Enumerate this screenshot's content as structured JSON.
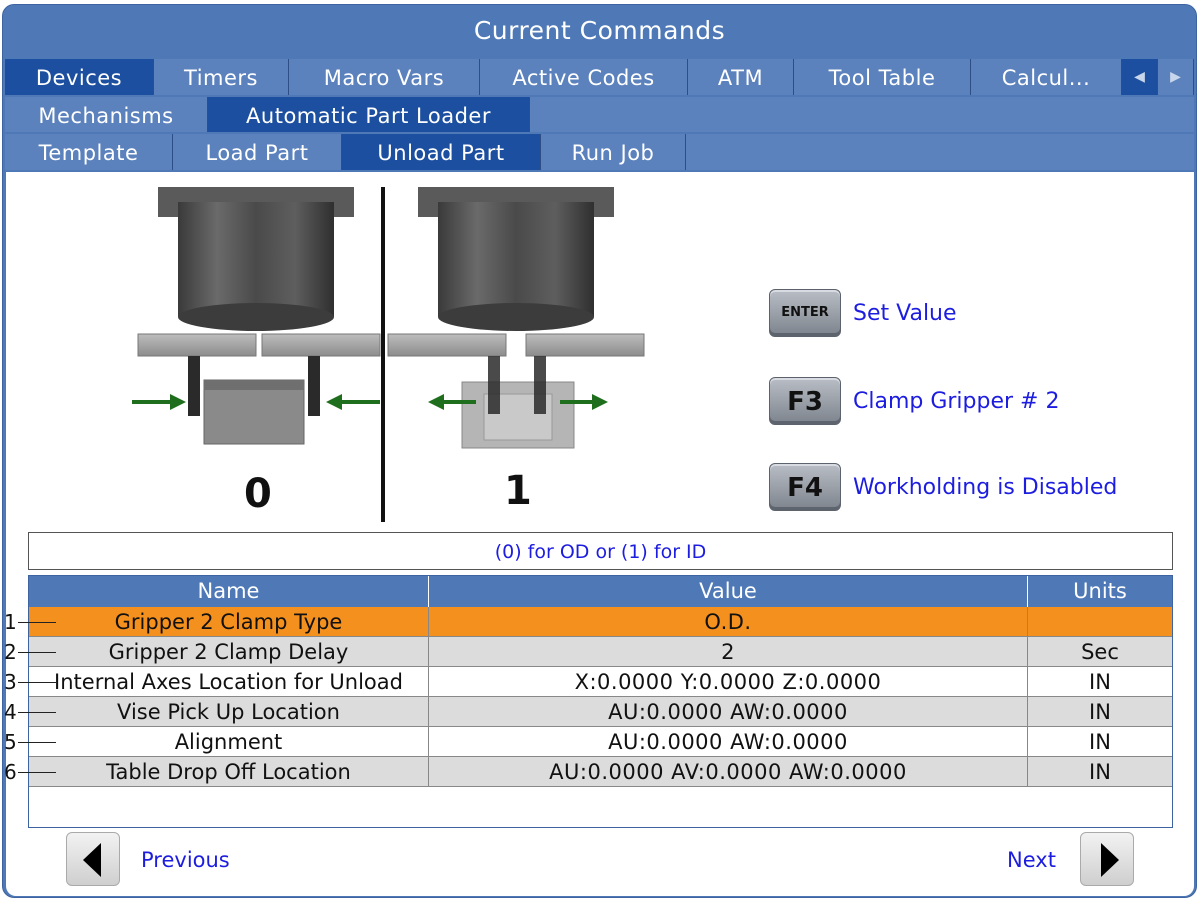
{
  "title": "Current Commands",
  "tabs_row1": [
    {
      "label": "Devices",
      "active": true
    },
    {
      "label": "Timers",
      "active": false
    },
    {
      "label": "Macro Vars",
      "active": false
    },
    {
      "label": "Active Codes",
      "active": false
    },
    {
      "label": "ATM",
      "active": false
    },
    {
      "label": "Tool Table",
      "active": false
    },
    {
      "label": "Calcul...",
      "active": false
    }
  ],
  "tabs_row2": [
    {
      "label": "Mechanisms",
      "active": false
    },
    {
      "label": "Automatic Part Loader",
      "active": true
    }
  ],
  "tabs_row3": [
    {
      "label": "Template",
      "active": false
    },
    {
      "label": "Load Part",
      "active": false
    },
    {
      "label": "Unload Part",
      "active": true
    },
    {
      "label": "Run Job",
      "active": false
    }
  ],
  "illustration": {
    "left_label": "0",
    "right_label": "1"
  },
  "keys": [
    {
      "key": "ENTER",
      "label": "Set Value"
    },
    {
      "key": "F3",
      "label": "Clamp Gripper # 2"
    },
    {
      "key": "F4",
      "label": "Workholding is Disabled"
    }
  ],
  "hint": "(0) for OD or (1) for ID",
  "table": {
    "headers": [
      "Name",
      "Value",
      "Units"
    ],
    "rows": [
      {
        "num": "1",
        "name": "Gripper 2 Clamp Type",
        "value": "O.D.",
        "units": ""
      },
      {
        "num": "2",
        "name": "Gripper 2 Clamp Delay",
        "value": "2",
        "units": "Sec"
      },
      {
        "num": "3",
        "name": "Internal Axes Location for Unload",
        "value": "X:0.0000 Y:0.0000 Z:0.0000",
        "units": "IN"
      },
      {
        "num": "4",
        "name": "Vise Pick Up Location",
        "value": "AU:0.0000 AW:0.0000",
        "units": "IN"
      },
      {
        "num": "5",
        "name": "Alignment",
        "value": "AU:0.0000 AW:0.0000",
        "units": "IN"
      },
      {
        "num": "6",
        "name": "Table Drop Off Location",
        "value": "AU:0.0000 AV:0.0000 AW:0.0000",
        "units": "IN"
      }
    ],
    "selected_row": 0
  },
  "nav": {
    "previous": "Previous",
    "next": "Next"
  },
  "colors": {
    "frame": "#4f79b6",
    "active_tab": "#1c4f9f",
    "selected_row": "#f4901e",
    "link_text": "#1d1de0"
  }
}
